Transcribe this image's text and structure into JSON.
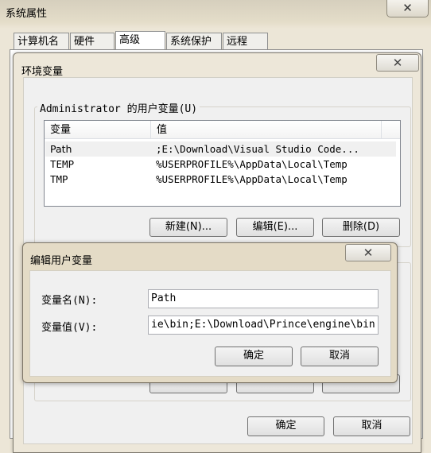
{
  "system_properties": {
    "title": "系统属性",
    "close_glyph": "✕",
    "tabs": [
      "计算机名",
      "硬件",
      "高级",
      "系统保护",
      "远程"
    ],
    "selected_tab": "高级"
  },
  "env_dialog": {
    "title": "环境变量",
    "close_glyph": "✕",
    "user_group_label": "Administrator 的用户变量(U)",
    "columns": [
      "变量",
      "值"
    ],
    "rows": [
      {
        "name": "Path",
        "value": ";E:\\Download\\Visual Studio Code..."
      },
      {
        "name": "TEMP",
        "value": "%USERPROFILE%\\AppData\\Local\\Temp"
      },
      {
        "name": "TMP",
        "value": "%USERPROFILE%\\AppData\\Local\\Temp"
      }
    ],
    "new_button": "新建(N)...",
    "edit_button": "编辑(E)...",
    "delete_button": "删除(D)",
    "ok_button": "确定",
    "cancel_button": "取消"
  },
  "edit_dialog": {
    "title": "编辑用户变量",
    "close_glyph": "✕",
    "name_label": "变量名(N):",
    "name_value": "Path",
    "value_label": "变量值(V):",
    "value_value": "ie\\bin;E:\\Download\\Prince\\engine\\bin",
    "ok_button": "确定",
    "cancel_button": "取消"
  }
}
